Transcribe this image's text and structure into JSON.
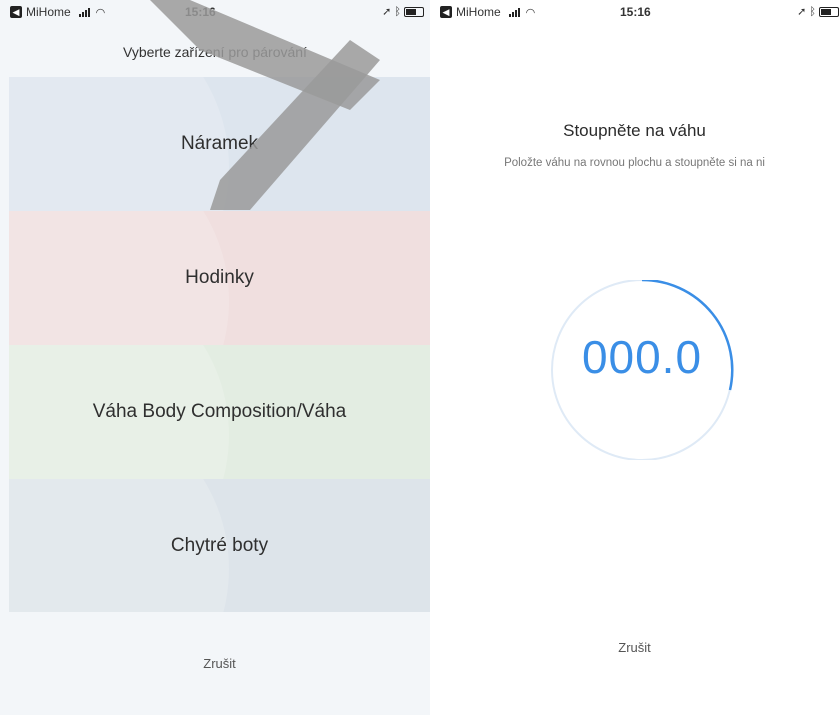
{
  "left_screen": {
    "status_bar": {
      "carrier": "MiHome",
      "time": "15:16"
    },
    "title": "Vyberte zařízení pro párování",
    "devices": [
      {
        "label": "Náramek",
        "color": "#dde5ee"
      },
      {
        "label": "Hodinky",
        "color": "#f0dfdf"
      },
      {
        "label": "Váha Body Composition/Váha",
        "color": "#e3ede2"
      },
      {
        "label": "Chytré boty",
        "color": "#dde4ea"
      }
    ],
    "cancel_label": "Zrušit"
  },
  "right_screen": {
    "status_bar": {
      "carrier": "MiHome",
      "time": "15:16"
    },
    "title": "Stoupněte na váhu",
    "subtitle": "Položte váhu na rovnou plochu a stoupněte si na ni",
    "weight_value": "000.0",
    "accent_color": "#3a8ee6",
    "cancel_label": "Zrušit"
  },
  "icons": [
    "app-badge-icon",
    "signal-icon",
    "wifi-icon",
    "location-icon",
    "bluetooth-icon",
    "battery-icon"
  ]
}
